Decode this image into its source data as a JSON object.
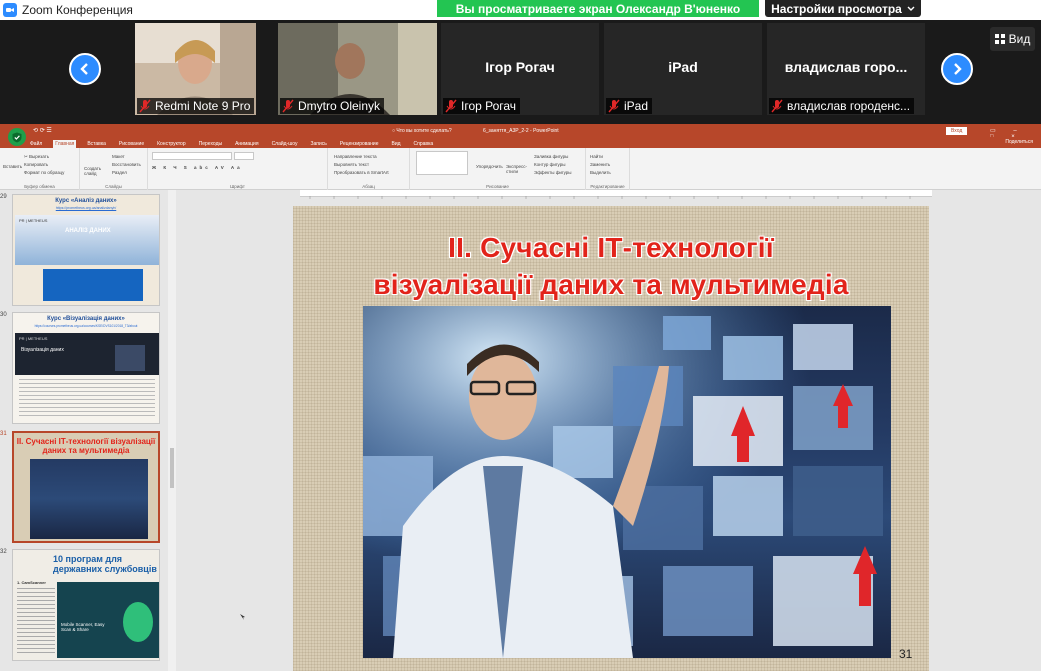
{
  "zoom": {
    "window_title": "Zoom Конференция",
    "share_banner": "Вы просматриваете экран Олександр В'юненко",
    "view_settings": "Настройки просмотра",
    "view_button": "Вид",
    "accent": "#2d8cff",
    "banner_color": "#23c552"
  },
  "participants": [
    {
      "label": "Redmi Note 9 Pro",
      "has_video": true,
      "center_name": ""
    },
    {
      "label": "Dmytro Oleinyk",
      "has_video": true,
      "center_name": ""
    },
    {
      "label": "Ігор Рогач",
      "has_video": false,
      "center_name": "Ігор Рогач"
    },
    {
      "label": "iPad",
      "has_video": false,
      "center_name": "iPad"
    },
    {
      "label": "владислав городенс...",
      "has_video": false,
      "center_name": "владислав горо..."
    }
  ],
  "powerpoint": {
    "doc_title": "6_заняття_А3Р_2-2  -  PowerPoint",
    "enter_button": "Вход",
    "tell_me": "Что вы хотите сделать?",
    "share": "Поделиться",
    "tabs": [
      "Файл",
      "Главная",
      "Вставка",
      "Рисование",
      "Конструктор",
      "Переходы",
      "Анимация",
      "Слайд-шоу",
      "Запись",
      "Рецензирование",
      "Вид",
      "Справка"
    ],
    "active_tab": "Главная",
    "ribbon": {
      "paste": "Вставить",
      "cut": "Вырезать",
      "copy": "Копировать",
      "format_painter": "Формат по образцу",
      "clipboard_group": "Буфер обмена",
      "new_slide": "Создать слайд",
      "layout": "Макет",
      "reset": "Восстановить",
      "section": "Раздел",
      "slides_group": "Слайды",
      "font_group": "Шрифт",
      "paragraph_group": "Абзац",
      "text_direction": "Направление текста",
      "align_text": "Выровнять текст",
      "smartart": "Преобразовать в SmartArt",
      "drawing_group": "Рисование",
      "arrange": "Упорядочить",
      "quick_styles": "Экспресс-стили",
      "shape_fill": "Заливка фигуры",
      "shape_outline": "Контур фигуры",
      "shape_effects": "Эффекты фигуры",
      "find": "Найти",
      "replace": "Заменить",
      "select": "Выделить",
      "editing_group": "Редактирование"
    },
    "brand_color": "#b7472a"
  },
  "thumbnails": [
    {
      "num": "29",
      "title": "Курс «Аналіз даних»",
      "link": "https://prometheus.org.ua/analizdanyh/",
      "banner": "АНАЛІЗ ДАНИХ",
      "logo": "PR | METHEUS"
    },
    {
      "num": "30",
      "title": "Курс «Візуалізація даних»",
      "link": "https://courses.prometheus.org.ua/courses/KSE/DVS101/2018_T3/about",
      "banner": "Візуалізація даних",
      "logo": "PR | METHEUS"
    },
    {
      "num": "31",
      "title": "ІІ. Сучасні  ІТ-технології візуалізації даних та мультимедіа",
      "selected": true
    },
    {
      "num": "32",
      "title": "10 програм для державних службовців",
      "subtitle": "1. CamScanner",
      "caption": "Mobile Scanner, Easy Scan & Share"
    }
  ],
  "slide": {
    "title_line1": "ІІ. Сучасні  ІТ-технології",
    "title_line2": "візуалізації даних та мультимедіа",
    "number": "31",
    "title_color": "#e2231a"
  }
}
